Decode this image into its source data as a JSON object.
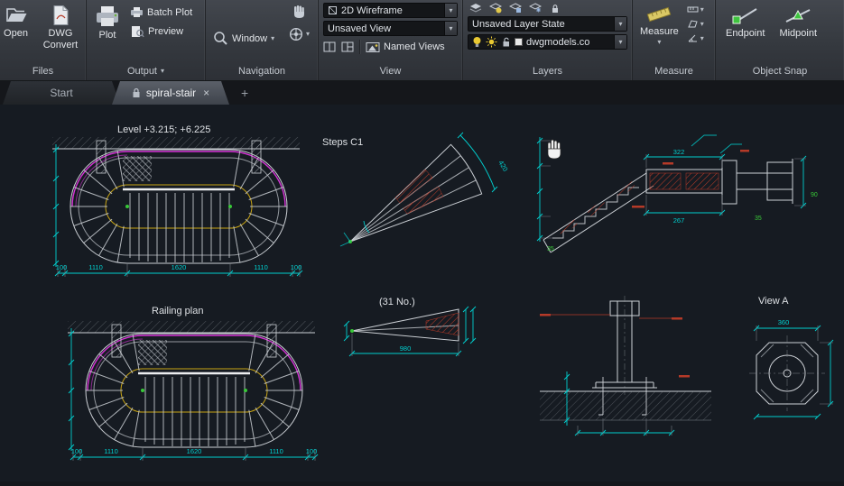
{
  "colors": {
    "cyan": "#00cfcf",
    "magenta": "#d633d6",
    "yellow": "#c8a414",
    "red_hatch": "#b53a28",
    "green": "#38c838",
    "canvas_bg": "#161b22",
    "ribbon_bg": "#35393f"
  },
  "glyphs": {
    "dropdown": "▾",
    "close": "×",
    "plus": "+"
  },
  "ribbon": {
    "files": {
      "label": "Files",
      "open": "Open",
      "dwg_convert": "DWG Convert"
    },
    "output": {
      "label": "Output",
      "plot": "Plot",
      "batch_plot": "Batch Plot",
      "preview": "Preview"
    },
    "navigation": {
      "label": "Navigation",
      "window": "Window"
    },
    "view": {
      "label": "View",
      "wireframe": "2D Wireframe",
      "view_combo": "Unsaved View",
      "named_views": "Named Views"
    },
    "layers": {
      "label": "Layers",
      "state_combo": "Unsaved Layer State",
      "layer_combo": "dwgmodels.co"
    },
    "measure": {
      "label": "Measure",
      "measure": "Measure"
    },
    "osnap": {
      "label": "Object Snap",
      "endpoint": "Endpoint",
      "midpoint": "Midpoint"
    }
  },
  "tabs": {
    "start": "Start",
    "active": "spiral-stair"
  },
  "drawing": {
    "level_label": "Level +3.215; +6.225",
    "steps_label": "Steps C1",
    "railing_label": "Railing plan",
    "count_label": "(31 No.)",
    "view_a_label": "View A",
    "dims": {
      "plan_bottom": [
        "100",
        "1110",
        "1620",
        "1110",
        "100"
      ],
      "detail_length": "980",
      "view_a_width": "360",
      "section_top": "322",
      "section_bottom": "267",
      "wedge_dim": "420",
      "green_a": "35",
      "green_b": "35",
      "green_c": "90"
    }
  }
}
